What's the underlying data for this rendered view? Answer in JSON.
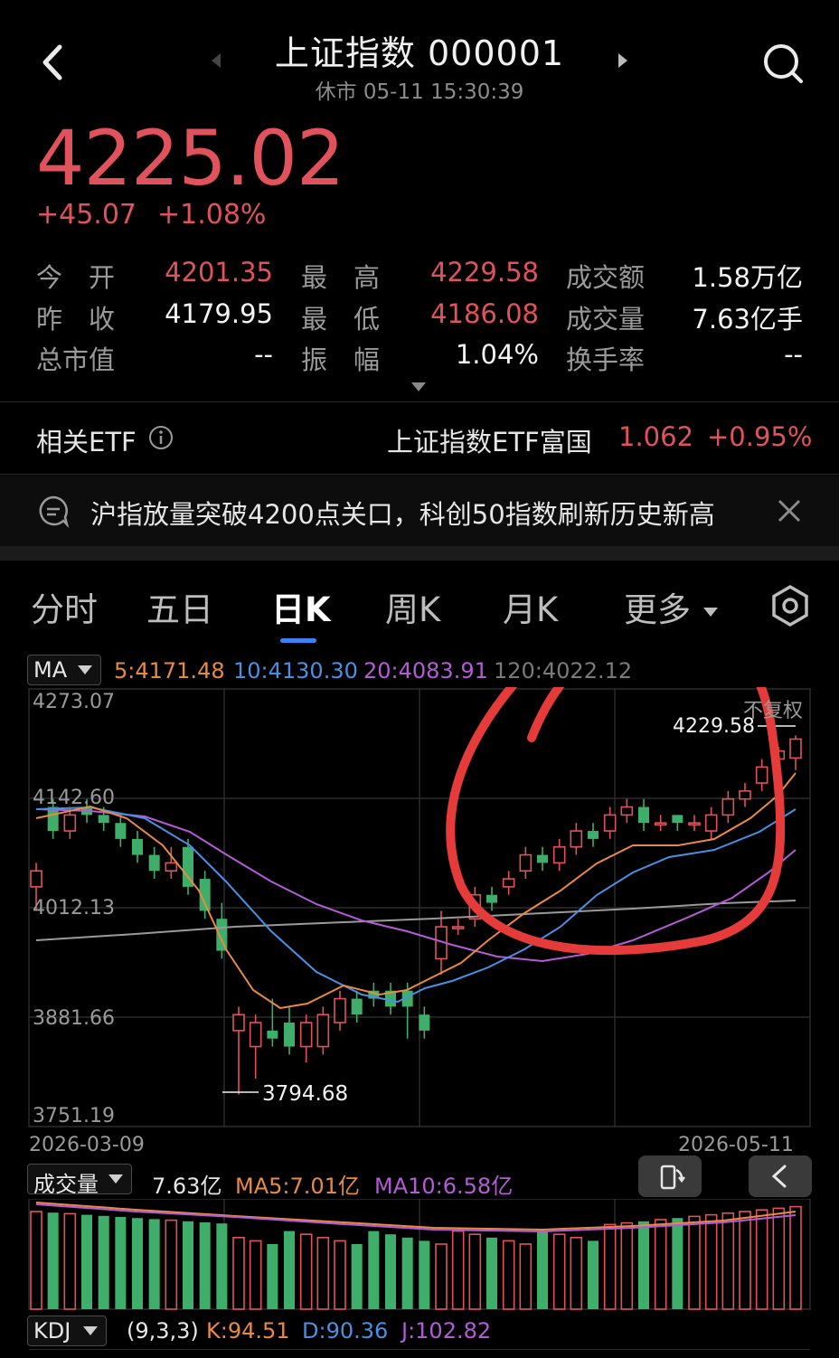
{
  "header": {
    "title": "上证指数 000001",
    "subtitle": "休市 05-11 15:30:39"
  },
  "quote": {
    "price": "4225.02",
    "change": "+45.07",
    "change_pct": "+1.08%"
  },
  "stats": [
    {
      "label": "今　开",
      "value": "4201.35",
      "color": "red"
    },
    {
      "label": "最　高",
      "value": "4229.58",
      "color": "red"
    },
    {
      "label": "成交额",
      "value": "1.58万亿",
      "color": "white"
    },
    {
      "label": "昨　收",
      "value": "4179.95",
      "color": "white"
    },
    {
      "label": "最　低",
      "value": "4186.08",
      "color": "red"
    },
    {
      "label": "成交量",
      "value": "7.63亿手",
      "color": "white"
    },
    {
      "label": "总市值",
      "value": "--",
      "color": "white"
    },
    {
      "label": "振　幅",
      "value": "1.04%",
      "color": "white"
    },
    {
      "label": "换手率",
      "value": "--",
      "color": "white"
    }
  ],
  "etf": {
    "label": "相关ETF",
    "name": "上证指数ETF富国",
    "price": "1.062",
    "change_pct": "+0.95%"
  },
  "news": {
    "text": "沪指放量突破4200点关口，科创50指数刷新历史新高"
  },
  "tabs": [
    "分时",
    "五日",
    "日K",
    "周K",
    "月K",
    "更多"
  ],
  "active_tab": "日K",
  "ma_legend": {
    "selector": "MA",
    "ma5": "5:4171.48",
    "ma10": "10:4130.30",
    "ma20": "20:4083.91",
    "ma120": "120:4022.12"
  },
  "chart_meta": {
    "y_ticks": [
      "4273.07",
      "4142.60",
      "4012.13",
      "3881.66",
      "3751.19"
    ],
    "start_date": "2026-03-09",
    "end_date": "2026-05-11",
    "adjust_label": "不复权",
    "high_label": "4229.58",
    "low_label": "3794.68"
  },
  "volume_legend": {
    "selector": "成交量",
    "value": "7.63亿",
    "ma5": "MA5:7.01亿",
    "ma10": "MA10:6.58亿"
  },
  "kdj_legend": {
    "selector": "KDJ",
    "params": "(9,3,3)",
    "k": "K:94.51",
    "d": "D:90.36",
    "j": "J:102.82"
  },
  "colors": {
    "up": "#e0525c",
    "down": "#3fae6a",
    "ma5": "#e98a44",
    "ma10": "#4a90e2",
    "ma20": "#b45bd6",
    "ma120": "#9a9a9a",
    "accent": "#3b82f6",
    "annotation": "#e53b3b"
  },
  "chart_data": {
    "type": "candlestick",
    "dates_range": [
      "2026-03-09",
      "2026-05-11"
    ],
    "ylim": [
      3751.19,
      4273.07
    ],
    "candles": [
      [
        4040,
        4060,
        4010,
        4070
      ],
      [
        4140,
        4110,
        4100,
        4150
      ],
      [
        4110,
        4130,
        4100,
        4140
      ],
      [
        4140,
        4130,
        4120,
        4150
      ],
      [
        4130,
        4120,
        4110,
        4140
      ],
      [
        4120,
        4100,
        4090,
        4130
      ],
      [
        4100,
        4080,
        4070,
        4110
      ],
      [
        4080,
        4060,
        4050,
        4090
      ],
      [
        4060,
        4070,
        4050,
        4090
      ],
      [
        4090,
        4040,
        4030,
        4100
      ],
      [
        4050,
        4010,
        4000,
        4060
      ],
      [
        4000,
        3960,
        3950,
        4020
      ],
      [
        3860,
        3880,
        3780,
        3890
      ],
      [
        3840,
        3870,
        3800,
        3880
      ],
      [
        3860,
        3850,
        3840,
        3900
      ],
      [
        3870,
        3840,
        3830,
        3890
      ],
      [
        3840,
        3870,
        3820,
        3880
      ],
      [
        3840,
        3880,
        3830,
        3890
      ],
      [
        3870,
        3900,
        3860,
        3910
      ],
      [
        3900,
        3880,
        3870,
        3910
      ],
      [
        3910,
        3900,
        3890,
        3920
      ],
      [
        3910,
        3890,
        3880,
        3920
      ],
      [
        3910,
        3890,
        3850,
        3920
      ],
      [
        3880,
        3860,
        3850,
        3890
      ],
      [
        3950,
        3990,
        3930,
        4010
      ],
      [
        3990,
        3990,
        3980,
        4000
      ],
      [
        4000,
        4030,
        3990,
        4040
      ],
      [
        4030,
        4020,
        4010,
        4040
      ],
      [
        4040,
        4050,
        4030,
        4060
      ],
      [
        4060,
        4080,
        4050,
        4090
      ],
      [
        4080,
        4070,
        4060,
        4090
      ],
      [
        4070,
        4090,
        4060,
        4100
      ],
      [
        4090,
        4110,
        4080,
        4120
      ],
      [
        4110,
        4100,
        4090,
        4120
      ],
      [
        4110,
        4130,
        4100,
        4140
      ],
      [
        4130,
        4140,
        4120,
        4150
      ],
      [
        4140,
        4120,
        4110,
        4150
      ],
      [
        4120,
        4120,
        4110,
        4130
      ],
      [
        4130,
        4120,
        4110,
        4130
      ],
      [
        4120,
        4120,
        4110,
        4130
      ],
      [
        4110,
        4130,
        4100,
        4140
      ],
      [
        4130,
        4150,
        4120,
        4160
      ],
      [
        4150,
        4160,
        4140,
        4170
      ],
      [
        4170,
        4190,
        4160,
        4200
      ],
      [
        4200,
        4210,
        4190,
        4215
      ],
      [
        4201.35,
        4225.02,
        4186.08,
        4229.58
      ]
    ],
    "annotation": "red hand-drawn circle around recent rally"
  }
}
